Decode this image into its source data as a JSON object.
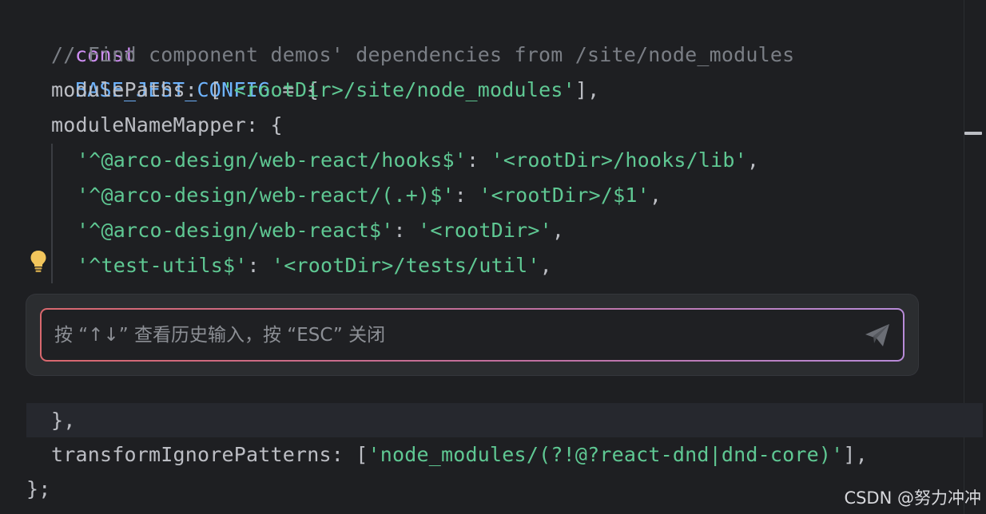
{
  "editor": {
    "lines": {
      "l1": {
        "kw": "const",
        "name": "BASE_JEST_CONFIG",
        "rest": " = {"
      },
      "l2": {
        "comment": "// Find component demos' dependencies from /site/node_modules"
      },
      "l3": {
        "prop": "modulePaths",
        "colon": ": [",
        "str": "'<rootDir>/site/node_modules'",
        "end": "],"
      },
      "l4": {
        "prop": "moduleNameMapper",
        "rest": ": {"
      },
      "l5": {
        "key": "'^@arco-design/web-react/hooks$'",
        "colon": ": ",
        "val": "'<rootDir>/hooks/lib'",
        "end": ","
      },
      "l6": {
        "key": "'^@arco-design/web-react/(.+)$'",
        "colon": ": ",
        "val": "'<rootDir>/$1'",
        "end": ","
      },
      "l7": {
        "key": "'^@arco-design/web-react$'",
        "colon": ": ",
        "val": "'<rootDir>'",
        "end": ","
      },
      "l8": {
        "key": "'^test-utils$'",
        "colon": ": ",
        "val": "'<rootDir>/tests/util'",
        "end": ","
      },
      "l9": {
        "text": "},"
      },
      "l10": {
        "prop": "transformIgnorePatterns",
        "colon": ": [",
        "str": "'node_modules/(?!@?react-dnd|dnd-core)'",
        "end": "],"
      },
      "l11": {
        "text": "};"
      }
    }
  },
  "ai_prompt": {
    "placeholder": "按 “↑↓” 查看历史输入，按 “ESC” 关闭",
    "value": "",
    "send_icon": "send-icon"
  },
  "intention_icon": "lightbulb-icon",
  "watermark": "CSDN @努力冲冲",
  "colors": {
    "background": "#1e1f22",
    "keyword": "#cf8ef4",
    "constant": "#6fb4ff",
    "comment": "#7a7e85",
    "string": "#6aab73",
    "panel": "#2b2d30",
    "gradient_start": "#d9686e",
    "gradient_end": "#b88bd8"
  }
}
